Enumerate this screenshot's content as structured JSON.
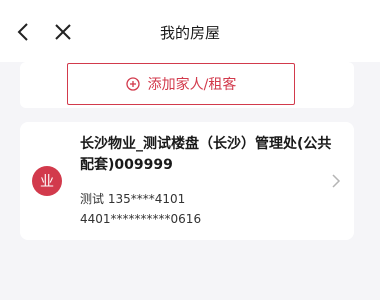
{
  "header": {
    "title": "我的房屋"
  },
  "add_button": {
    "label": "添加家人/租客"
  },
  "property_card": {
    "avatar_text": "业",
    "title": "长沙物业_测试楼盘（长沙）管理处(公共配套)009999",
    "contact": "测试 135****4101",
    "id_number": "4401**********0616"
  },
  "colors": {
    "accent": "#d23a4c",
    "background": "#f5f5f8"
  }
}
